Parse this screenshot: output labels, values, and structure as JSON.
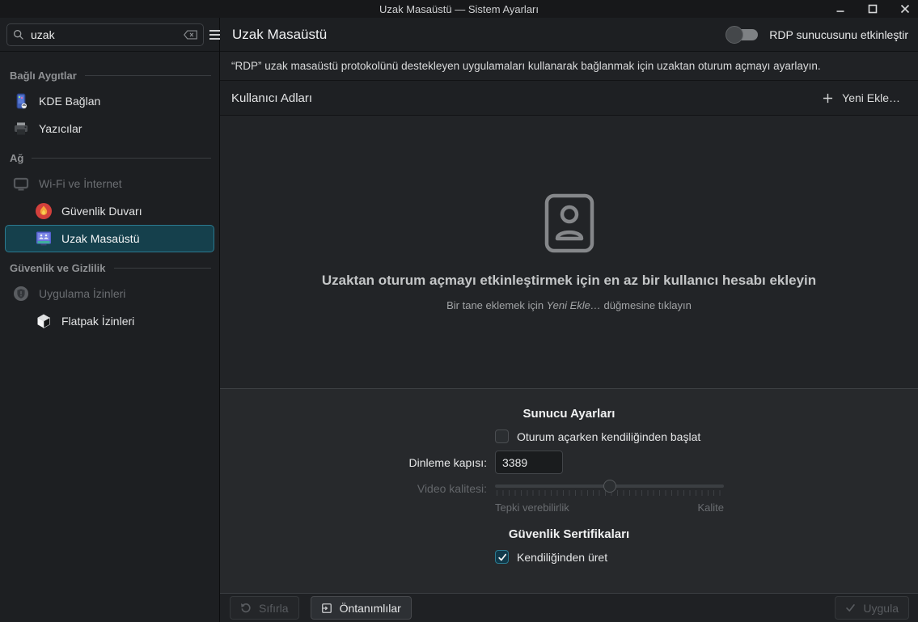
{
  "window": {
    "title": "Uzak Masaüstü — Sistem Ayarları"
  },
  "toolbar": {
    "search_value": "uzak",
    "page_title": "Uzak Masaüstü",
    "rdp_toggle_label": "RDP sunucusunu etkinleştir",
    "rdp_toggle_on": false
  },
  "sidebar": {
    "sections": [
      {
        "label": "Bağlı Aygıtlar",
        "items": [
          {
            "label": "KDE Bağlan"
          },
          {
            "label": "Yazıcılar"
          }
        ]
      },
      {
        "label": "Ağ",
        "items": [
          {
            "label": "Wi-Fi ve İnternet"
          },
          {
            "label": "Güvenlik Duvarı"
          },
          {
            "label": "Uzak Masaüstü"
          }
        ]
      },
      {
        "label": "Güvenlik ve Gizlilik",
        "items": [
          {
            "label": "Uygulama İzinleri"
          },
          {
            "label": "Flatpak İzinleri"
          }
        ]
      }
    ]
  },
  "content": {
    "description": "“RDP” uzak masaüstü protokolünü destekleyen uygulamaları kullanarak bağlanmak için uzaktan oturum açmayı ayarlayın.",
    "usernames": {
      "title": "Kullanıcı Adları",
      "add_button_label": "Yeni Ekle…"
    },
    "empty_state": {
      "heading": "Uzaktan oturum açmayı etkinleştirmek için en az bir kullanıcı hesabı ekleyin",
      "hint_prefix": "Bir tane eklemek için ",
      "hint_emphasis": "Yeni Ekle…",
      "hint_suffix": " düğmesine tıklayın"
    },
    "server_settings": {
      "title": "Sunucu Ayarları",
      "autostart_label": "Oturum açarken kendiliğinden başlat",
      "autostart_checked": false,
      "port_label": "Dinleme kapısı:",
      "port_value": "3389",
      "video_quality_label": "Video kalitesi:",
      "video_quality_enabled": false,
      "slider_percent": 50,
      "quality_min_label": "Tepki verebilirlik",
      "quality_max_label": "Kalite"
    },
    "certificates": {
      "title": "Güvenlik Sertifikaları",
      "autogenerate_label": "Kendiliğinden üret",
      "autogenerate_checked": true
    }
  },
  "footer": {
    "reset_label": "Sıfırla",
    "defaults_label": "Öntanımlılar",
    "apply_label": "Uygula"
  },
  "colors": {
    "accent_teal": "#2b7a90",
    "selection_bg": "#15404c",
    "firewall_red": "#d3403c",
    "flame_orange": "#f5a43a",
    "kdeconnect_blue": "#3f5fb8"
  }
}
